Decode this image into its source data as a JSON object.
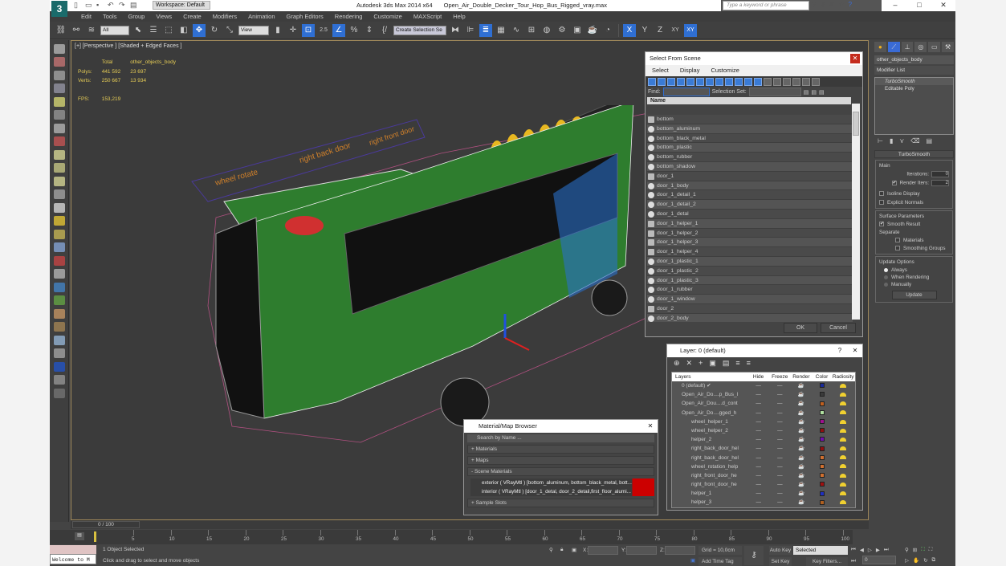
{
  "window": {
    "app": "Autodesk 3ds Max  2014 x64",
    "file": "Open_Air_Double_Decker_Tour_Hop_Bus_Rigged_vray.max",
    "workspace": "Workspace: Default",
    "search_placeholder": "Type a keyword or phrase",
    "minimize": "–",
    "maximize": "□",
    "close": "✕"
  },
  "menu": [
    "Edit",
    "Tools",
    "Group",
    "Views",
    "Create",
    "Modifiers",
    "Animation",
    "Graph Editors",
    "Rendering",
    "Customize",
    "MAXScript",
    "Help"
  ],
  "toolbar": {
    "filter": "All",
    "ref_coord": "View",
    "selection_set": "Create Selection Se",
    "snap_angle": "2.5",
    "axes": [
      "X",
      "Y",
      "Z",
      "XY",
      "XY"
    ]
  },
  "viewport": {
    "label": "[+] [Perspective ] [Shaded + Edged Faces ]",
    "stats": {
      "col1": "Total",
      "col2": "other_objects_body",
      "polys_label": "Polys:",
      "polys_total": "441 592",
      "polys_obj": "23 697",
      "verts_label": "Verts:",
      "verts_total": "250 667",
      "verts_obj": "13 934",
      "fps_label": "FPS:",
      "fps": "153,219"
    },
    "helper_labels": [
      "wheel rotate",
      "right back door",
      "right front door"
    ]
  },
  "select_from_scene": {
    "title": "Select From Scene",
    "menu": [
      "Select",
      "Display",
      "Customize"
    ],
    "find_label": "Find:",
    "selection_set_label": "Selection Set:",
    "column": "Name",
    "objects": [
      {
        "name": "bottom",
        "type": "group"
      },
      {
        "name": "bottom_aluminum",
        "type": "geo"
      },
      {
        "name": "bottom_black_metal",
        "type": "geo"
      },
      {
        "name": "bottom_plastic",
        "type": "geo"
      },
      {
        "name": "bottom_rubber",
        "type": "geo"
      },
      {
        "name": "bottom_shadow",
        "type": "geo"
      },
      {
        "name": "door_1",
        "type": "group"
      },
      {
        "name": "door_1_body",
        "type": "geo"
      },
      {
        "name": "door_1_detail_1",
        "type": "geo"
      },
      {
        "name": "door_1_detail_2",
        "type": "geo"
      },
      {
        "name": "door_1_detal",
        "type": "geo"
      },
      {
        "name": "door_1_helper_1",
        "type": "helper"
      },
      {
        "name": "door_1_helper_2",
        "type": "helper"
      },
      {
        "name": "door_1_helper_3",
        "type": "helper"
      },
      {
        "name": "door_1_helper_4",
        "type": "helper"
      },
      {
        "name": "door_1_plastic_1",
        "type": "geo"
      },
      {
        "name": "door_1_plastic_2",
        "type": "geo"
      },
      {
        "name": "door_1_plastic_3",
        "type": "geo"
      },
      {
        "name": "door_1_rubber",
        "type": "geo"
      },
      {
        "name": "door_1_window",
        "type": "geo"
      },
      {
        "name": "door_2",
        "type": "group"
      },
      {
        "name": "door_2_body",
        "type": "geo"
      }
    ],
    "ok": "OK",
    "cancel": "Cancel"
  },
  "layer_dialog": {
    "title": "Layer: 0 (default)",
    "help": "?",
    "headers": [
      "Layers",
      "Hide",
      "Freeze",
      "Render",
      "Color",
      "Radiosity"
    ],
    "rows": [
      {
        "name": "0 (default)",
        "check": "✔",
        "color": "#1a2a9a"
      },
      {
        "name": "Open_Air_Do....p_Bus_I",
        "color": "#3a3a3a"
      },
      {
        "name": "Open_Air_Dou....d_cont",
        "color": "#c06020"
      },
      {
        "name": "Open_Air_Do....gged_h",
        "color": "#b0e0a0"
      },
      {
        "name": "wheel_helper_1",
        "color": "#a01090"
      },
      {
        "name": "wheel_helper_2",
        "color": "#901010"
      },
      {
        "name": "helper_2",
        "color": "#7010b0"
      },
      {
        "name": "right_back_door_hel",
        "color": "#901010"
      },
      {
        "name": "right_back_door_hel",
        "color": "#d07030"
      },
      {
        "name": "wheel_rotation_help",
        "color": "#d07030"
      },
      {
        "name": "right_front_door_he",
        "color": "#d07030"
      },
      {
        "name": "right_front_door_he",
        "color": "#a01010"
      },
      {
        "name": "helper_1",
        "color": "#2030c0"
      },
      {
        "name": "helper_3",
        "color": "#b06020"
      }
    ],
    "dash": "—"
  },
  "material_browser": {
    "title": "Material/Map Browser",
    "search": "Search by Name ...",
    "sections": [
      "+ Materials",
      "+ Maps",
      "- Scene Materials",
      "+ Sample Slots"
    ],
    "materials": [
      "exterior ( VRayMtl ) [bottom_aluminum, bottom_black_metal, bott...",
      "interior ( VRayMtl ) [door_1_detal, door_2_detail,first_floor_alumi..."
    ]
  },
  "command_panel": {
    "object_name": "other_objects_body",
    "modifier_list": "Modifier List",
    "stack": [
      "TurboSmooth",
      "Editable Poly"
    ],
    "rollout": "TurboSmooth",
    "main": "Main",
    "iterations_label": "Iterations:",
    "iterations": "0",
    "render_iters_label": "Render Iters:",
    "render_iters": "2",
    "isoline": "Isoline Display",
    "explicit_normals": "Explicit Normals",
    "surface_params": "Surface Parameters",
    "smooth_result": "Smooth Result",
    "separate": "Separate",
    "materials": "Materials",
    "smoothing_groups": "Smoothing Groups",
    "update_options": "Update Options",
    "always": "Always",
    "when_rendering": "When Rendering",
    "manually": "Manually",
    "update": "Update"
  },
  "timeline": {
    "frame": "0 / 100",
    "ticks": [
      "5",
      "10",
      "15",
      "20",
      "25",
      "30",
      "35",
      "40",
      "45",
      "50",
      "55",
      "60",
      "65",
      "70",
      "75",
      "80",
      "85",
      "90",
      "95",
      "100"
    ]
  },
  "status": {
    "selected": "1 Object Selected",
    "prompt": "Click and drag to select and move objects",
    "welcome": "Welcome to M",
    "x": "X:",
    "y": "Y:",
    "z": "Z:",
    "grid": "Grid = 10,0cm",
    "add_time_tag": "Add Time Tag",
    "auto_key": "Auto Key",
    "set_key": "Set Key",
    "key_mode": "Selected",
    "key_filters": "Key Filters...",
    "frame_field": "0"
  }
}
